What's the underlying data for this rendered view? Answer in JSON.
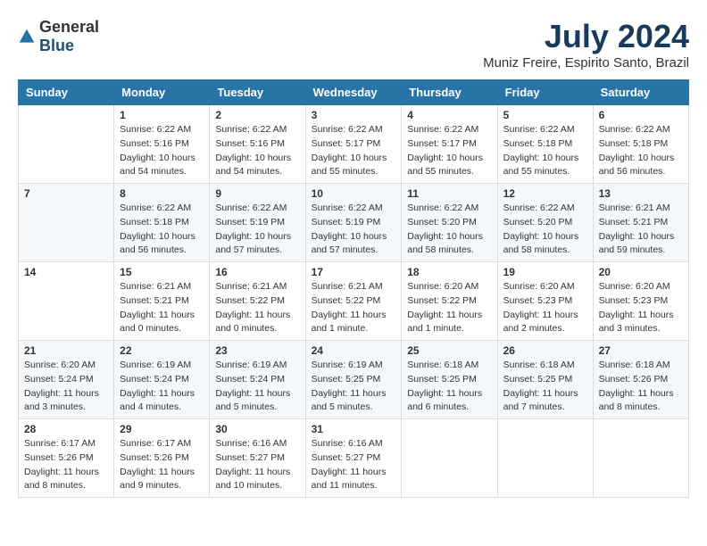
{
  "header": {
    "logo_general": "General",
    "logo_blue": "Blue",
    "month_title": "July 2024",
    "location": "Muniz Freire, Espirito Santo, Brazil"
  },
  "weekdays": [
    "Sunday",
    "Monday",
    "Tuesday",
    "Wednesday",
    "Thursday",
    "Friday",
    "Saturday"
  ],
  "weeks": [
    [
      {
        "day": "",
        "info": ""
      },
      {
        "day": "1",
        "info": "Sunrise: 6:22 AM\nSunset: 5:16 PM\nDaylight: 10 hours\nand 54 minutes."
      },
      {
        "day": "2",
        "info": "Sunrise: 6:22 AM\nSunset: 5:16 PM\nDaylight: 10 hours\nand 54 minutes."
      },
      {
        "day": "3",
        "info": "Sunrise: 6:22 AM\nSunset: 5:17 PM\nDaylight: 10 hours\nand 55 minutes."
      },
      {
        "day": "4",
        "info": "Sunrise: 6:22 AM\nSunset: 5:17 PM\nDaylight: 10 hours\nand 55 minutes."
      },
      {
        "day": "5",
        "info": "Sunrise: 6:22 AM\nSunset: 5:18 PM\nDaylight: 10 hours\nand 55 minutes."
      },
      {
        "day": "6",
        "info": "Sunrise: 6:22 AM\nSunset: 5:18 PM\nDaylight: 10 hours\nand 56 minutes."
      }
    ],
    [
      {
        "day": "7",
        "info": ""
      },
      {
        "day": "8",
        "info": "Sunrise: 6:22 AM\nSunset: 5:18 PM\nDaylight: 10 hours\nand 56 minutes."
      },
      {
        "day": "9",
        "info": "Sunrise: 6:22 AM\nSunset: 5:19 PM\nDaylight: 10 hours\nand 57 minutes."
      },
      {
        "day": "10",
        "info": "Sunrise: 6:22 AM\nSunset: 5:19 PM\nDaylight: 10 hours\nand 57 minutes."
      },
      {
        "day": "11",
        "info": "Sunrise: 6:22 AM\nSunset: 5:20 PM\nDaylight: 10 hours\nand 58 minutes."
      },
      {
        "day": "12",
        "info": "Sunrise: 6:22 AM\nSunset: 5:20 PM\nDaylight: 10 hours\nand 58 minutes."
      },
      {
        "day": "13",
        "info": "Sunrise: 6:21 AM\nSunset: 5:21 PM\nDaylight: 10 hours\nand 59 minutes."
      }
    ],
    [
      {
        "day": "14",
        "info": ""
      },
      {
        "day": "15",
        "info": "Sunrise: 6:21 AM\nSunset: 5:21 PM\nDaylight: 11 hours\nand 0 minutes."
      },
      {
        "day": "16",
        "info": "Sunrise: 6:21 AM\nSunset: 5:22 PM\nDaylight: 11 hours\nand 0 minutes."
      },
      {
        "day": "17",
        "info": "Sunrise: 6:21 AM\nSunset: 5:22 PM\nDaylight: 11 hours\nand 1 minute."
      },
      {
        "day": "18",
        "info": "Sunrise: 6:20 AM\nSunset: 5:22 PM\nDaylight: 11 hours\nand 1 minute."
      },
      {
        "day": "19",
        "info": "Sunrise: 6:20 AM\nSunset: 5:23 PM\nDaylight: 11 hours\nand 2 minutes."
      },
      {
        "day": "20",
        "info": "Sunrise: 6:20 AM\nSunset: 5:23 PM\nDaylight: 11 hours\nand 3 minutes."
      }
    ],
    [
      {
        "day": "21",
        "info": "Sunrise: 6:20 AM\nSunset: 5:24 PM\nDaylight: 11 hours\nand 3 minutes."
      },
      {
        "day": "22",
        "info": "Sunrise: 6:19 AM\nSunset: 5:24 PM\nDaylight: 11 hours\nand 4 minutes."
      },
      {
        "day": "23",
        "info": "Sunrise: 6:19 AM\nSunset: 5:24 PM\nDaylight: 11 hours\nand 5 minutes."
      },
      {
        "day": "24",
        "info": "Sunrise: 6:19 AM\nSunset: 5:25 PM\nDaylight: 11 hours\nand 5 minutes."
      },
      {
        "day": "25",
        "info": "Sunrise: 6:18 AM\nSunset: 5:25 PM\nDaylight: 11 hours\nand 6 minutes."
      },
      {
        "day": "26",
        "info": "Sunrise: 6:18 AM\nSunset: 5:25 PM\nDaylight: 11 hours\nand 7 minutes."
      },
      {
        "day": "27",
        "info": "Sunrise: 6:18 AM\nSunset: 5:26 PM\nDaylight: 11 hours\nand 8 minutes."
      }
    ],
    [
      {
        "day": "28",
        "info": "Sunrise: 6:17 AM\nSunset: 5:26 PM\nDaylight: 11 hours\nand 8 minutes."
      },
      {
        "day": "29",
        "info": "Sunrise: 6:17 AM\nSunset: 5:26 PM\nDaylight: 11 hours\nand 9 minutes."
      },
      {
        "day": "30",
        "info": "Sunrise: 6:16 AM\nSunset: 5:27 PM\nDaylight: 11 hours\nand 10 minutes."
      },
      {
        "day": "31",
        "info": "Sunrise: 6:16 AM\nSunset: 5:27 PM\nDaylight: 11 hours\nand 11 minutes."
      },
      {
        "day": "",
        "info": ""
      },
      {
        "day": "",
        "info": ""
      },
      {
        "day": "",
        "info": ""
      }
    ]
  ]
}
